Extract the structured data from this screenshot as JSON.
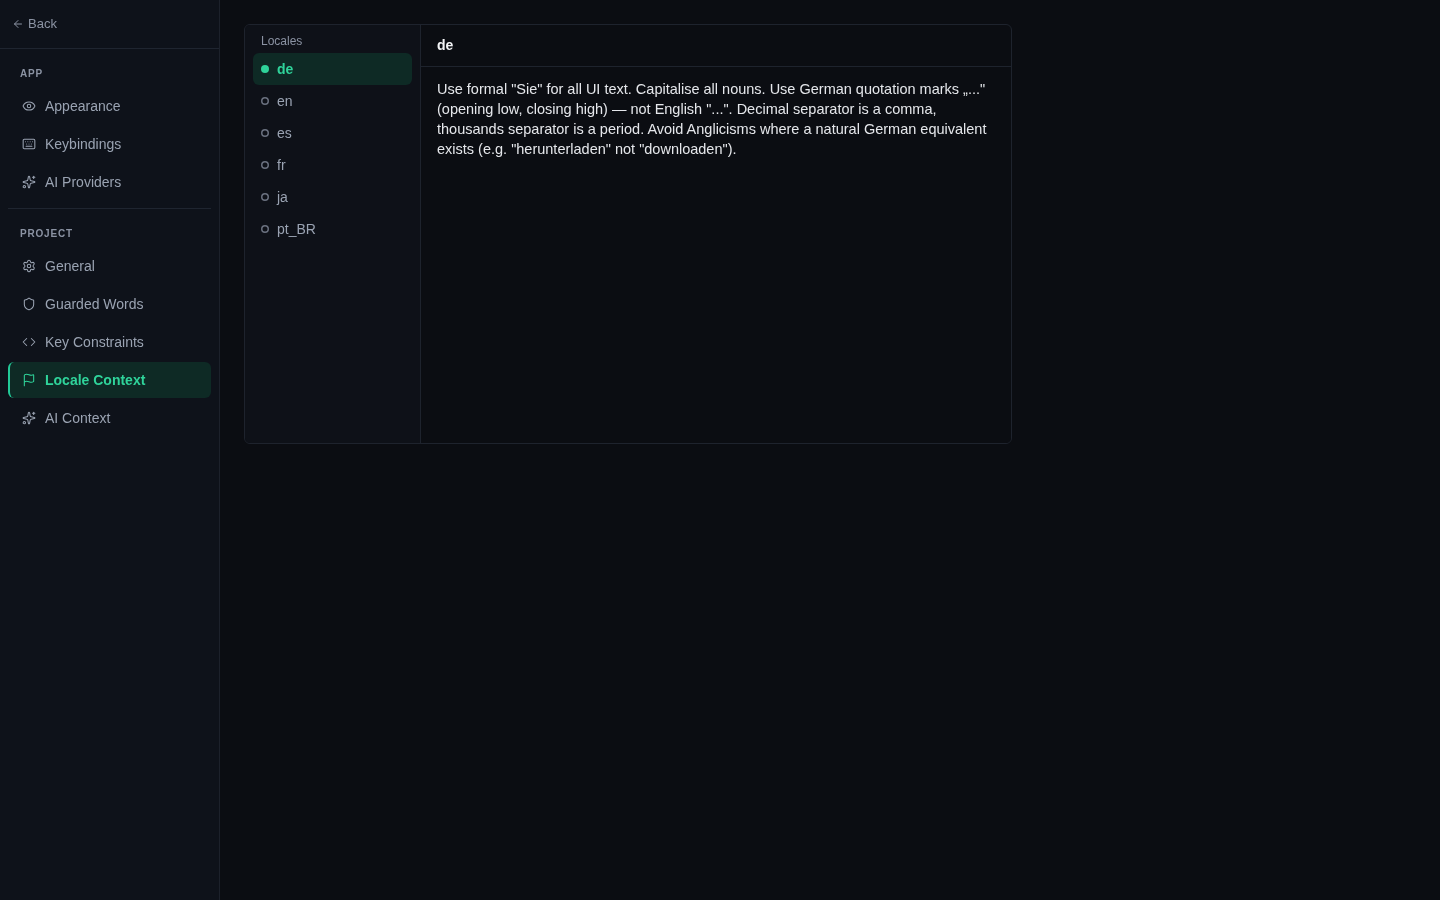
{
  "sidebar": {
    "back": "Back",
    "sections": [
      {
        "heading": "APP",
        "items": [
          {
            "label": "Appearance",
            "selected": false
          },
          {
            "label": "Keybindings",
            "selected": false
          },
          {
            "label": "AI Providers",
            "selected": false
          }
        ]
      },
      {
        "heading": "PROJECT",
        "items": [
          {
            "label": "General",
            "selected": false
          },
          {
            "label": "Guarded Words",
            "selected": false
          },
          {
            "label": "Key Constraints",
            "selected": false
          },
          {
            "label": "Locale Context",
            "selected": true
          },
          {
            "label": "AI Context",
            "selected": false
          }
        ]
      }
    ]
  },
  "locales": {
    "heading": "Locales",
    "items": [
      {
        "code": "de",
        "selected": true
      },
      {
        "code": "en",
        "selected": false
      },
      {
        "code": "es",
        "selected": false
      },
      {
        "code": "fr",
        "selected": false
      },
      {
        "code": "ja",
        "selected": false
      },
      {
        "code": "pt_BR",
        "selected": false
      }
    ]
  },
  "editor": {
    "title": "de",
    "value": "Use formal \"Sie\" for all UI text. Capitalise all nouns. Use German quotation marks „...\" (opening low, closing high) — not English \"...\". Decimal separator is a comma, thousands separator is a period. Avoid Anglicisms where a natural German equivalent exists (e.g. \"herunterladen\" not \"downloaden\")."
  }
}
